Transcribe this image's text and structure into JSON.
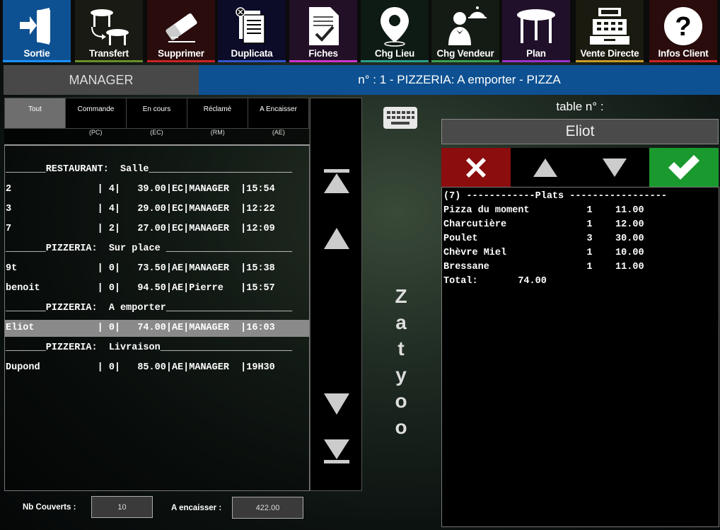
{
  "toolbar": [
    {
      "label": "Sortie",
      "icon": "exit-door-icon",
      "bg": "#0e5192",
      "bar": "#1e90ff"
    },
    {
      "label": "Transfert",
      "icon": "transfer-tables-icon",
      "bg": "#1a1a14",
      "bar": "#6a8f2a"
    },
    {
      "label": "Supprimer",
      "icon": "eraser-icon",
      "bg": "#2a0c0c",
      "bar": "#cc2222"
    },
    {
      "label": "Duplicata",
      "icon": "duplicate-icon",
      "bg": "#0c0c28",
      "bar": "#3355cc"
    },
    {
      "label": "Fiches",
      "icon": "form-check-icon",
      "bg": "#221026",
      "bar": "#cc33cc"
    },
    {
      "label": "Chg Lieu",
      "icon": "location-pin-icon",
      "bg": "#0e1a14",
      "bar": "#2aa08a"
    },
    {
      "label": "Chg Vendeur",
      "icon": "waiter-icon",
      "bg": "#141a14",
      "bar": "#3aa050"
    },
    {
      "label": "Plan",
      "icon": "table-plan-icon",
      "bg": "#20102a",
      "bar": "#9a33cc"
    },
    {
      "label": "Vente Directe",
      "icon": "cash-register-icon",
      "bg": "#1a1a10",
      "bar": "#c89a2a"
    },
    {
      "label": "Infos Client",
      "icon": "question-icon",
      "bg": "#2a0c0c",
      "bar": "#cc2222"
    }
  ],
  "header": {
    "user": "MANAGER",
    "title": "n° : 1 - PIZZERIA: A emporter - PIZZA"
  },
  "tabs": [
    {
      "label": "Tout",
      "sub": ""
    },
    {
      "label": "Commande",
      "sub": "(PC)"
    },
    {
      "label": "En cours",
      "sub": "(EC)"
    },
    {
      "label": "Réclamé",
      "sub": "(RM)"
    },
    {
      "label": "A Encaisser",
      "sub": "(AE)"
    }
  ],
  "orders": [
    {
      "text": "_______RESTAURANT:  Salle_________________________",
      "selected": false
    },
    {
      "text": "2               | 4|   39.00|EC|MANAGER  |15:54",
      "selected": false
    },
    {
      "text": "3               | 4|   29.00|EC|MANAGER  |12:22",
      "selected": false
    },
    {
      "text": "7               | 2|   27.00|EC|MANAGER  |12:09",
      "selected": false
    },
    {
      "text": "_______PIZZERIA:  Sur place ______________________",
      "selected": false
    },
    {
      "text": "9t              | 0|   73.50|AE|MANAGER  |15:38",
      "selected": false
    },
    {
      "text": "benoit          | 0|   94.50|AE|Pierre   |15:57",
      "selected": false
    },
    {
      "text": "_______PIZZERIA:  A emporter______________________",
      "selected": false
    },
    {
      "text": "Eliot           | 0|   74.00|AE|MANAGER  |16:03",
      "selected": true
    },
    {
      "text": "_______PIZZERIA:  Livraison_______________________",
      "selected": false
    },
    {
      "text": "Dupond          | 0|   85.00|AE|MANAGER  |19H30",
      "selected": false
    }
  ],
  "brand": [
    "Z",
    "a",
    "t",
    "y",
    "o",
    "o"
  ],
  "right": {
    "table_label": "table  n° :",
    "client_name": "Eliot"
  },
  "ticket": [
    "(7) ------------Plats -----------------",
    "Pizza du moment          1    11.00",
    "Charcutière              1    12.00",
    "Poulet                   3    30.00",
    "Chèvre Miel              1    10.00",
    "Bressane                 1    11.00",
    "",
    "Total:       74.00"
  ],
  "bottom": {
    "covers_label": "Nb Couverts :",
    "covers_value": "10",
    "due_label": "A encaisser :",
    "due_value": "422.00"
  }
}
